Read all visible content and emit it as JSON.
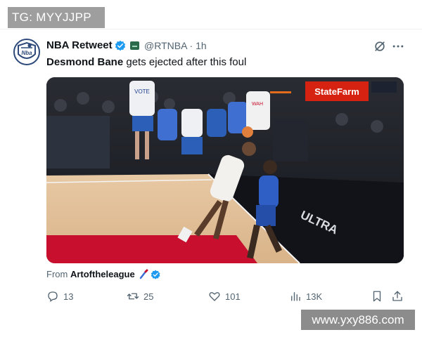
{
  "watermark_top": "TG: MYYJJPP",
  "watermark_bottom": "www.yxy886.com",
  "tweet": {
    "author_name": "NBA Retweet",
    "avatar_text": "Nba",
    "handle": "@RTNBA",
    "separator": "·",
    "time": "1h",
    "text_bold": "Desmond Bane",
    "text_rest": " gets ejected after this foul",
    "from_prefix": "From ",
    "from_account": "Artoftheleague"
  },
  "media": {
    "sponsor": "StateFarm",
    "jersey_text": "VOTE",
    "jersey_text_2": "WAH",
    "court_text": "ULTRA"
  },
  "actions": {
    "replies": "13",
    "retweets": "25",
    "likes": "101",
    "views": "13K"
  },
  "colors": {
    "verified": "#1d9bf0",
    "court_red": "#c8102e",
    "sponsor_red": "#d62311"
  }
}
